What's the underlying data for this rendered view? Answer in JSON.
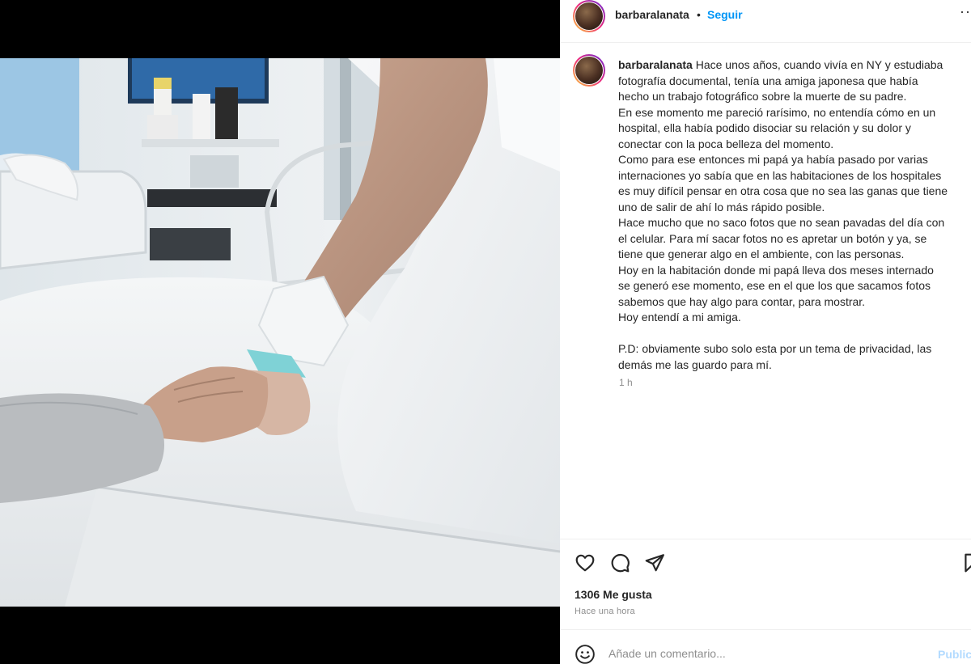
{
  "post": {
    "username": "barbaralanata",
    "follow_label": "Seguir",
    "separator": "•",
    "more_label": "··",
    "caption": {
      "username": "barbaralanata",
      "first_line": "Hace unos años, cuando vivía en NY y estudiaba",
      "lines": [
        "fotografía documental, tenía una amiga japonesa que había",
        "hecho un trabajo fotográfico sobre la muerte de su padre.",
        "En ese momento me pareció rarísimo, no entendía cómo en un",
        "hospital, ella había podido disociar su relación y su dolor y",
        "conectar con la poca belleza del momento.",
        "Como para ese entonces mi papá ya había pasado por varias",
        "internaciones yo sabía que en las habitaciones de los hospitales",
        "es muy difícil pensar en otra cosa que no sea las ganas que tiene",
        "uno de salir de ahí lo más rápido posible.",
        "Hace mucho que no saco fotos que no sean pavadas del día con",
        "el celular. Para mí sacar fotos no es apretar un botón y ya, se",
        "tiene que generar algo en el ambiente, con las personas.",
        "Hoy en la habitación donde mi papá lleva dos meses internado",
        "se generó ese momento, ese en el que los que sacamos fotos",
        "sabemos que hay algo para contar, para mostrar.",
        "Hoy entendí a mi amiga."
      ],
      "ps_lines": [
        "P.D: obviamente subo solo esta por un tema de privacidad, las",
        "demás me las guardo para mí."
      ],
      "time": "1 h"
    },
    "likes": "1306 Me gusta",
    "posted": "Hace una hora",
    "comment_placeholder": "Añade un comentario...",
    "publish_label": "Publicar",
    "icons": {
      "like": "heart-icon",
      "comment": "comment-icon",
      "share": "send-icon",
      "save": "bookmark-icon",
      "emoji": "emoji-icon"
    },
    "colors": {
      "link_blue": "#0095f6",
      "text": "#262626",
      "muted": "#8e8e8e",
      "publish_disabled": "#b3dbff"
    }
  }
}
